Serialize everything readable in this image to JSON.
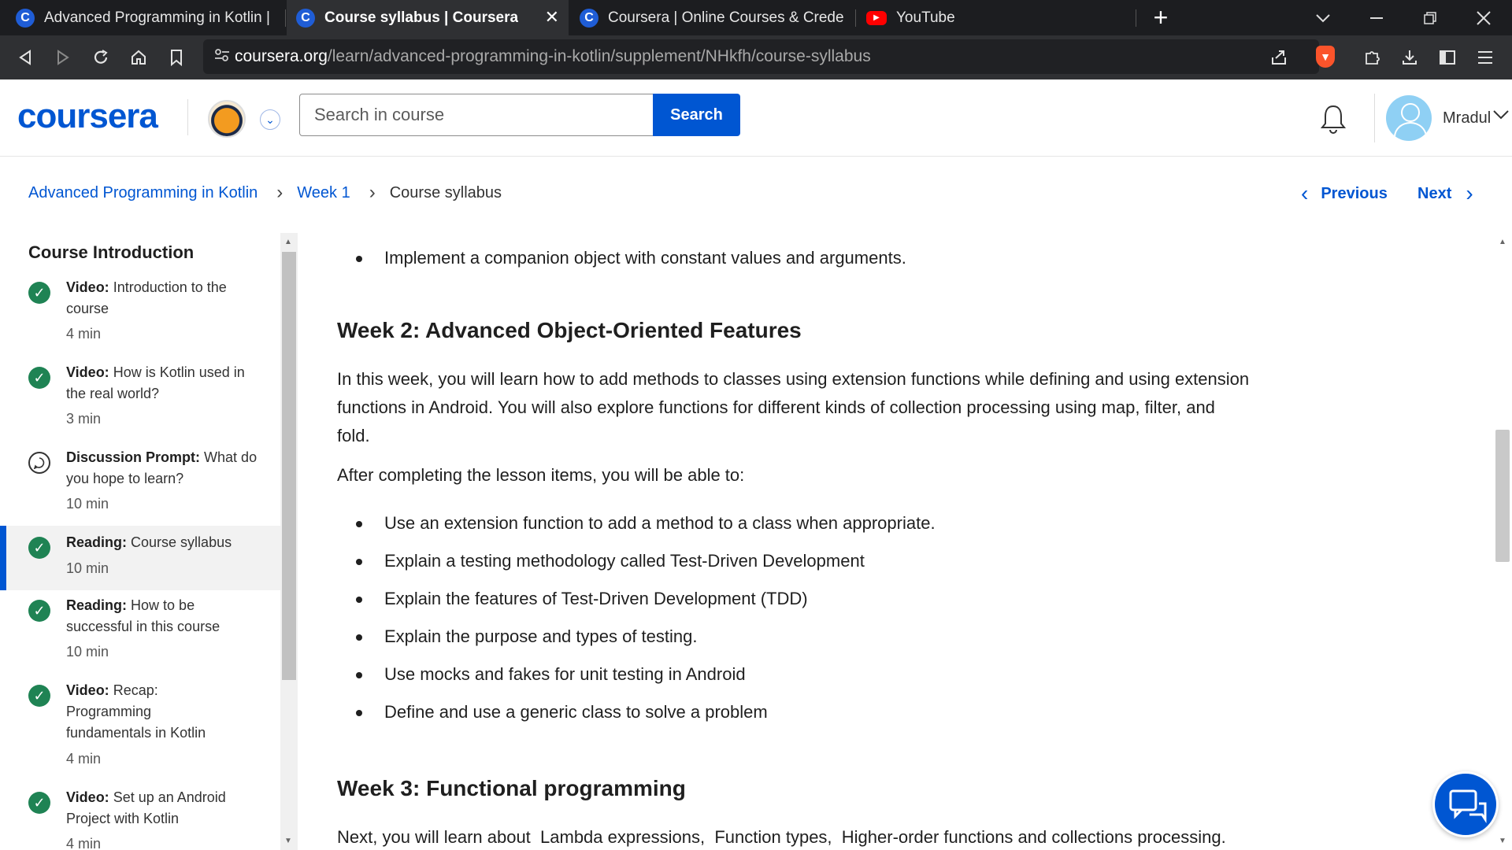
{
  "browser": {
    "tabs": [
      {
        "title": "Advanced Programming in Kotlin | Cou",
        "favicon": "C",
        "active": false
      },
      {
        "title": "Course syllabus | Coursera",
        "favicon": "C",
        "active": true,
        "close": "✕"
      },
      {
        "title": "Coursera | Online Courses & Credentia",
        "favicon": "C",
        "active": false
      },
      {
        "title": "YouTube",
        "favicon": "▶",
        "active": false
      }
    ],
    "new_tab": "+",
    "url_domain": "coursera.org",
    "url_path": "/learn/advanced-programming-in-kotlin/supplement/NHkfh/course-syllabus"
  },
  "header": {
    "logo": "coursera",
    "search_placeholder": "Search in course",
    "search_button": "Search",
    "user_name": "Mradul"
  },
  "breadcrumb": {
    "course": "Advanced Programming in Kotlin",
    "week": "Week 1",
    "current": "Course syllabus",
    "previous": "Previous",
    "next": "Next"
  },
  "sidebar": {
    "heading": "Course Introduction",
    "items": [
      {
        "type": "Video:",
        "title": "Introduction to the course",
        "duration": "4 min",
        "icon": "check-icon"
      },
      {
        "type": "Video:",
        "title": "How is Kotlin used in the real world?",
        "duration": "3 min",
        "icon": "check-icon"
      },
      {
        "type": "Discussion Prompt:",
        "title": "What do you hope to learn?",
        "duration": "10 min",
        "icon": "discussion-icon"
      },
      {
        "type": "Reading:",
        "title": "Course syllabus",
        "duration": "10 min",
        "icon": "check-icon",
        "active": true
      },
      {
        "type": "Reading:",
        "title": "How to be successful in this course",
        "duration": "10 min",
        "icon": "check-icon"
      },
      {
        "type": "Video:",
        "title": "Recap: Programming fundamentals in Kotlin",
        "duration": "4 min",
        "icon": "check-icon"
      },
      {
        "type": "Video:",
        "title": "Set up an Android Project with Kotlin",
        "duration": "4 min",
        "icon": "check-icon"
      }
    ]
  },
  "content": {
    "top_bullet": "Implement a companion object with constant values and arguments.",
    "week2_heading": "Week 2: Advanced Object-Oriented Features",
    "week2_intro": "In this week, you will learn how to add methods to classes using extension functions while defining and using extension functions in Android. You will also explore functions for different kinds of collection processing using map, filter, and fold.",
    "week2_after": "After completing the lesson items, you will be able to:",
    "week2_bullets": [
      "Use an extension function to add a method to a class when appropriate.",
      "Explain a testing methodology called Test-Driven Development",
      "Explain the features of Test-Driven Development (TDD)",
      "Explain the purpose and types of testing.",
      "Use mocks and fakes for unit testing in Android",
      "Define and use a generic class to solve a problem"
    ],
    "week3_heading": "Week 3: Functional programming",
    "week3_intro": "Next, you will learn about  Lambda expressions,  Function types,  Higher-order functions and collections processing."
  },
  "colors": {
    "brand": "#0056d2",
    "complete": "#1f8354",
    "chrome_bg": "#2f3033"
  }
}
